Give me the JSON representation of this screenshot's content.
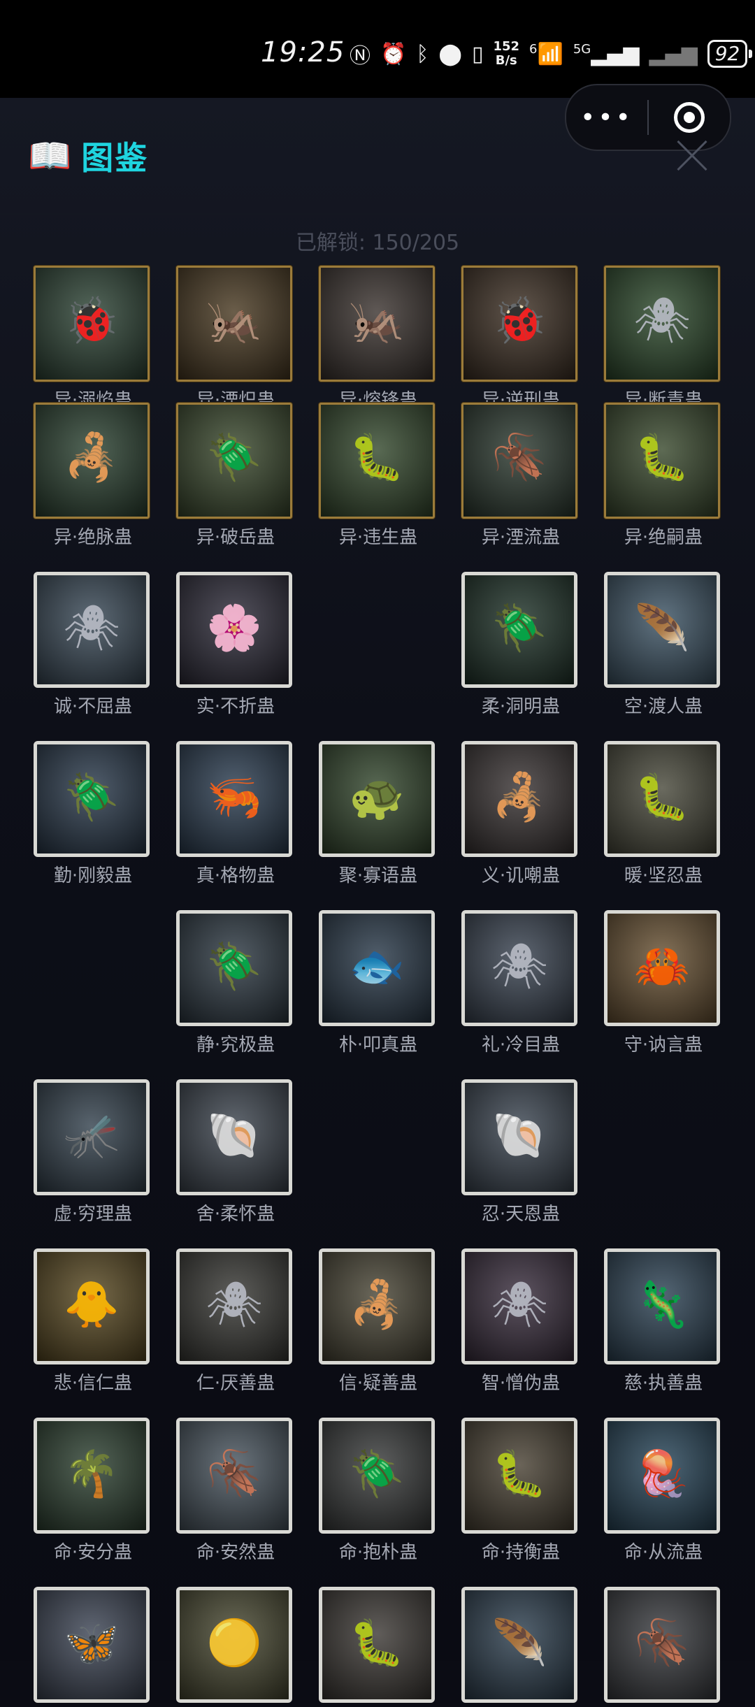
{
  "status_bar": {
    "time": "19:25",
    "net_speed_value": "152",
    "net_speed_unit": "B/s",
    "signal_label": "6",
    "network_label": "5G",
    "battery": "92"
  },
  "capsule": {
    "more_label": "•••"
  },
  "header": {
    "icon": "📖",
    "title": "图鉴"
  },
  "unlock_text": "已解锁: 150/205",
  "rows": [
    [
      {
        "label": "异·溺焰蛊",
        "frame": "gold",
        "icon": "ladybug-icon",
        "glyph": "🐞",
        "bg": "#2e4536"
      },
      {
        "label": "异·湮炽蛊",
        "frame": "gold",
        "icon": "cricket-icon",
        "glyph": "🦗",
        "bg": "#4a3a22"
      },
      {
        "label": "异·熔锋蛊",
        "frame": "gold",
        "icon": "mantis-icon",
        "glyph": "🦗",
        "bg": "#3c3430"
      },
      {
        "label": "异·逆刑蛊",
        "frame": "gold",
        "icon": "ladybug-icon",
        "glyph": "🐞",
        "bg": "#3e3024"
      },
      {
        "label": "异·断青蛊",
        "frame": "gold",
        "icon": "green-spider-icon",
        "glyph": "🕷",
        "bg": "#2d4a2c"
      }
    ],
    [
      {
        "label": "异·绝脉蛊",
        "frame": "gold",
        "icon": "scorpion-icon",
        "glyph": "🦂",
        "bg": "#2c4332"
      },
      {
        "label": "异·破岳蛊",
        "frame": "gold",
        "icon": "beetle-icon",
        "glyph": "🪲",
        "bg": "#3b4a2e"
      },
      {
        "label": "异·违生蛊",
        "frame": "gold",
        "icon": "larva-icon",
        "glyph": "🐛",
        "bg": "#354a2e"
      },
      {
        "label": "异·湮流蛊",
        "frame": "gold",
        "icon": "louse-icon",
        "glyph": "🪳",
        "bg": "#2c3a30"
      },
      {
        "label": "异·绝嗣蛊",
        "frame": "gold",
        "icon": "grub-icon",
        "glyph": "🐛",
        "bg": "#3a4a2e"
      }
    ],
    [
      {
        "label": "诚·不屈蛊",
        "frame": "bone",
        "icon": "rock-spider-icon",
        "glyph": "🕷",
        "bg": "#3a4a58"
      },
      {
        "label": "实·不折蛊",
        "frame": "bone",
        "icon": "flower-mantis-icon",
        "glyph": "🌸",
        "bg": "#2e2c3a"
      },
      null,
      {
        "label": "柔·洞明蛊",
        "frame": "bone",
        "icon": "glowing-beetle-icon",
        "glyph": "🪲",
        "bg": "#1f3329"
      },
      {
        "label": "空·渡人蛊",
        "frame": "bone",
        "icon": "feather-worm-icon",
        "glyph": "🪶",
        "bg": "#3e5566"
      }
    ],
    [
      {
        "label": "勤·刚毅蛊",
        "frame": "bone",
        "icon": "rhino-beetle-icon",
        "glyph": "🪲",
        "bg": "#2a3a4c"
      },
      {
        "label": "真·格物蛊",
        "frame": "bone",
        "icon": "shrimp-bug-icon",
        "glyph": "🦐",
        "bg": "#2c3e52"
      },
      {
        "label": "聚·寡语蛊",
        "frame": "bone",
        "icon": "shell-bug-icon",
        "glyph": "🐢",
        "bg": "#34482e"
      },
      {
        "label": "义·讥嘲蛊",
        "frame": "bone",
        "icon": "scorpion-icon",
        "glyph": "🦂",
        "bg": "#3a3434"
      },
      {
        "label": "暖·坚忍蛊",
        "frame": "bone",
        "icon": "glow-grub-icon",
        "glyph": "🐛",
        "bg": "#4a4a3c"
      }
    ],
    [
      null,
      {
        "label": "静·究极蛊",
        "frame": "bone",
        "icon": "dome-beetle-icon",
        "glyph": "🪲",
        "bg": "#2e3a44"
      },
      {
        "label": "朴·叩真蛊",
        "frame": "bone",
        "icon": "fish-icon",
        "glyph": "🐟",
        "bg": "#2a3a4a"
      },
      {
        "label": "礼·冷目蛊",
        "frame": "bone",
        "icon": "eyed-spider-icon",
        "glyph": "🕷",
        "bg": "#3a4452"
      },
      {
        "label": "守·讷言蛊",
        "frame": "bone",
        "icon": "crab-icon",
        "glyph": "🦀",
        "bg": "#6a5334"
      }
    ],
    [
      {
        "label": "虚·穷理蛊",
        "frame": "bone",
        "icon": "mayfly-icon",
        "glyph": "🦟",
        "bg": "#34424e"
      },
      {
        "label": "舍·柔怀蛊",
        "frame": "bone",
        "icon": "shell-creature-icon",
        "glyph": "🐚",
        "bg": "#3e4650"
      },
      null,
      {
        "label": "忍·天恩蛊",
        "frame": "bone",
        "icon": "ammonite-icon",
        "glyph": "🐚",
        "bg": "#3c4652"
      },
      null
    ],
    [
      {
        "label": "悲·信仁蛊",
        "frame": "bone",
        "icon": "glow-chick-icon",
        "glyph": "🐥",
        "bg": "#5a4a22"
      },
      {
        "label": "仁·厌善蛊",
        "frame": "bone",
        "icon": "spider-icon",
        "glyph": "🕷",
        "bg": "#3a3a36"
      },
      {
        "label": "信·疑善蛊",
        "frame": "bone",
        "icon": "scorpion-icon",
        "glyph": "🦂",
        "bg": "#4a4636"
      },
      {
        "label": "智·憎伪蛊",
        "frame": "bone",
        "icon": "orb-spider-icon",
        "glyph": "🕷",
        "bg": "#3a2e3e"
      },
      {
        "label": "慈·执善蛊",
        "frame": "bone",
        "icon": "axolotl-icon",
        "glyph": "🦎",
        "bg": "#2e4456"
      }
    ],
    [
      {
        "label": "命·安分蛊",
        "frame": "bone",
        "icon": "palm-anemone-icon",
        "glyph": "🌴",
        "bg": "#2e4232"
      },
      {
        "label": "命·安然蛊",
        "frame": "bone",
        "icon": "pillbug-icon",
        "glyph": "🪳",
        "bg": "#4a5660"
      },
      {
        "label": "命·抱朴蛊",
        "frame": "bone",
        "icon": "cicada-icon",
        "glyph": "🪲",
        "bg": "#3a3c3c"
      },
      {
        "label": "命·持衡蛊",
        "frame": "bone",
        "icon": "grub-icon",
        "glyph": "🐛",
        "bg": "#4a4234"
      },
      {
        "label": "命·从流蛊",
        "frame": "bone",
        "icon": "jellyfish-icon",
        "glyph": "🪼",
        "bg": "#28465a"
      }
    ],
    [
      {
        "label": "",
        "frame": "bone",
        "icon": "moth-icon",
        "glyph": "🦋",
        "bg": "#3e4656"
      },
      {
        "label": "",
        "frame": "bone",
        "icon": "glow-orb-icon",
        "glyph": "🟡",
        "bg": "#4a4a32"
      },
      {
        "label": "",
        "frame": "bone",
        "icon": "larva-icon",
        "glyph": "🐛",
        "bg": "#3e3a36"
      },
      {
        "label": "",
        "frame": "bone",
        "icon": "feather-icon",
        "glyph": "🪶",
        "bg": "#2e4050"
      },
      {
        "label": "",
        "frame": "bone",
        "icon": "isopod-icon",
        "glyph": "🪳",
        "bg": "#3a3c40"
      }
    ]
  ]
}
